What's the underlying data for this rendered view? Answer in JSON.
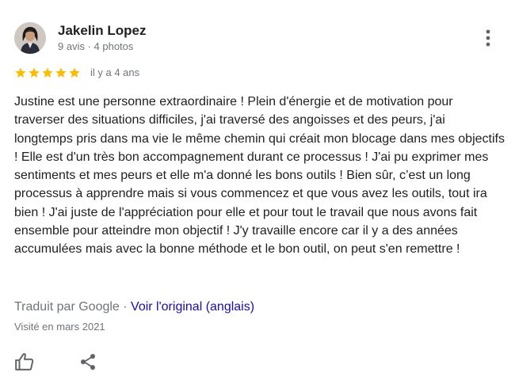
{
  "review": {
    "author": {
      "name": "Jakelin Lopez",
      "meta": "9 avis · 4 photos",
      "avatar_icon": "profile-photo"
    },
    "rating": 5,
    "rating_max": 5,
    "star_color": "#fbbc04",
    "time_ago": "il y a 4 ans",
    "text": "Justine est une personne extraordinaire ! Plein d'énergie et de motivation pour traverser des situations difficiles, j'ai traversé des angoisses et des peurs, j'ai longtemps pris dans ma vie le même chemin qui créait mon blocage dans mes objectifs ! Elle est d'un très bon accompagnement durant ce processus ! J'ai pu exprimer mes sentiments et mes peurs et elle m'a donné les bons outils ! Bien sûr, c’est un long processus à apprendre mais si vous commencez et que vous avez les outils, tout ira bien ! J'ai juste de l'appréciation pour elle et pour tout le travail que nous avons fait ensemble pour atteindre mon objectif ! J'y travaille encore car il y a des années accumulées mais avec la bonne méthode et le bon outil, on peut s'en remettre !",
    "translated_label": "Traduit par Google",
    "separator": " · ",
    "view_original_label": "Voir l'original (anglais)",
    "visited": "Visité en mars 2021"
  },
  "actions": {
    "more_icon": "more-vert-icon",
    "like_icon": "thumbs-up-icon",
    "share_icon": "share-icon"
  },
  "colors": {
    "text_primary": "#202124",
    "text_secondary": "#70757a",
    "link": "#1a0dab",
    "icon": "#5f6368"
  }
}
